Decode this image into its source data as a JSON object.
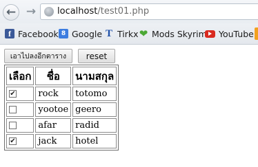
{
  "browser": {
    "url_host": "localhost",
    "url_path": "/test01.php",
    "bookmarks": [
      {
        "label": "Facebook",
        "icon": "facebook-icon"
      },
      {
        "label": "Google",
        "icon": "google-icon"
      },
      {
        "label": "Tirkx",
        "icon": "tirkx-icon"
      },
      {
        "label": "Mods Skyrim",
        "icon": "mods-skyrim-icon"
      },
      {
        "label": "YouTube",
        "icon": "youtube-icon"
      }
    ]
  },
  "page": {
    "move_button_label": "เอาไปลงอีกตาราง",
    "reset_button_label": "reset",
    "table": {
      "headers": [
        "เลือก",
        "ชื่อ",
        "นามสกุล"
      ],
      "rows": [
        {
          "checked": true,
          "name": "rock",
          "surname": "totomo"
        },
        {
          "checked": false,
          "name": "yootoe",
          "surname": "geero"
        },
        {
          "checked": false,
          "name": "afar",
          "surname": "radid"
        },
        {
          "checked": true,
          "name": "jack",
          "surname": "hotel"
        }
      ]
    }
  }
}
